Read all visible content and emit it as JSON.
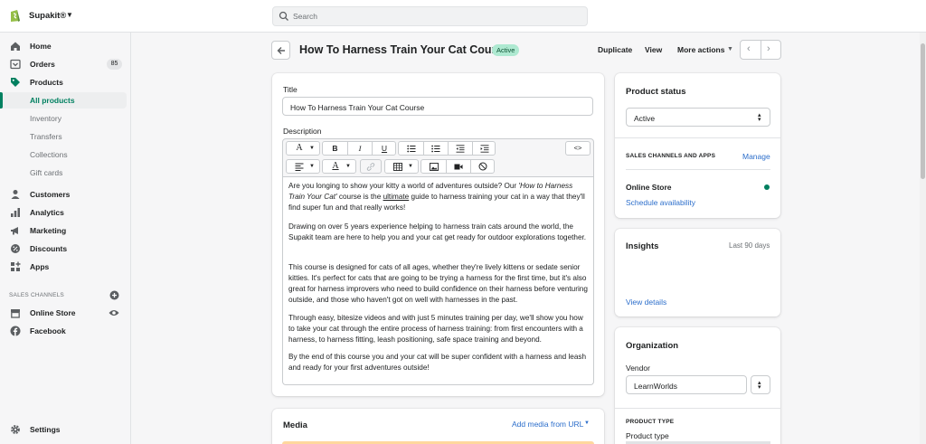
{
  "topbar": {
    "store_name": "Supakit®",
    "search_placeholder": "Search",
    "colors": {
      "brand": "#008060",
      "background": "#ffffff"
    }
  },
  "sidebar": {
    "items": [
      {
        "label": "Home",
        "icon": "home-icon"
      },
      {
        "label": "Orders",
        "icon": "orders-icon",
        "badge": "85"
      },
      {
        "label": "Products",
        "icon": "tag-icon"
      },
      {
        "label": "All products",
        "active": true
      },
      {
        "label": "Inventory"
      },
      {
        "label": "Transfers"
      },
      {
        "label": "Collections"
      },
      {
        "label": "Gift cards"
      },
      {
        "label": "Customers",
        "icon": "person-icon"
      },
      {
        "label": "Analytics",
        "icon": "analytics-icon"
      },
      {
        "label": "Marketing",
        "icon": "marketing-icon"
      },
      {
        "label": "Discounts",
        "icon": "discount-icon"
      },
      {
        "label": "Apps",
        "icon": "apps-icon"
      }
    ],
    "sales_channels_label": "SALES CHANNELS",
    "channels": [
      {
        "label": "Online Store",
        "icon": "store-icon"
      },
      {
        "label": "Facebook",
        "icon": "facebook-icon"
      }
    ],
    "settings_label": "Settings"
  },
  "header": {
    "title": "How To Harness Train Your Cat Course",
    "status": "Active",
    "actions": {
      "duplicate": "Duplicate",
      "view": "View",
      "more": "More actions"
    }
  },
  "product_form": {
    "title_label": "Title",
    "title_value": "How To Harness Train Your Cat Course",
    "description_label": "Description",
    "toolbar": {
      "row1": [
        "A",
        "B",
        "I",
        "U",
        "bullet-list-icon",
        "numbered-list-icon",
        "outdent-icon",
        "indent-icon",
        "<>"
      ],
      "row2": [
        "align-icon",
        "text-color-icon",
        "link-icon",
        "table-icon",
        "image-icon",
        "video-icon",
        "clear-formatting-icon"
      ]
    },
    "description": {
      "p1_before": "Are you longing to show your kitty a world of adventures outside? Our ",
      "p1_em": "'How to Harness Train Your Cat'",
      "p1_mid": " course is the ",
      "p1_u": "ultimate",
      "p1_after": " guide to harness training your cat in a way that they'll find super fun and that really works!",
      "p2": "Drawing on over 5 years experience helping to harness train cats around the world, the Supakit team are here to help you and your cat get ready for outdoor explorations together.",
      "p3": "This course is designed for cats of all ages, whether they're lively kittens or sedate senior kitties. It's perfect for cats that are going to be trying a harness for the first time, but it's also great for harness improvers who need to build confidence on their harness before venturing outside, and those who haven't got on well with harnesses in the past.",
      "p4": "Through easy, bitesize videos and with just 5 minutes training per day, we'll show you how to take your cat through the entire process of harness training: from first encounters with a harness, to harness fitting, leash positioning, safe space training and beyond.",
      "p5": "By the end of this course you and your cat will be super confident with a harness and leash and ready for your first adventures outside!"
    }
  },
  "media": {
    "title": "Media",
    "add_from_url": "Add media from URL"
  },
  "product_status": {
    "title": "Product status",
    "value": "Active",
    "channels_label": "SALES CHANNELS AND APPS",
    "manage": "Manage",
    "online_store": "Online Store",
    "schedule": "Schedule availability"
  },
  "insights": {
    "title": "Insights",
    "period": "Last 90 days",
    "view_details": "View details"
  },
  "organization": {
    "title": "Organization",
    "vendor_label": "Vendor",
    "vendor_value": "LearnWorlds",
    "product_type_header": "PRODUCT TYPE",
    "product_type_label": "Product type"
  }
}
